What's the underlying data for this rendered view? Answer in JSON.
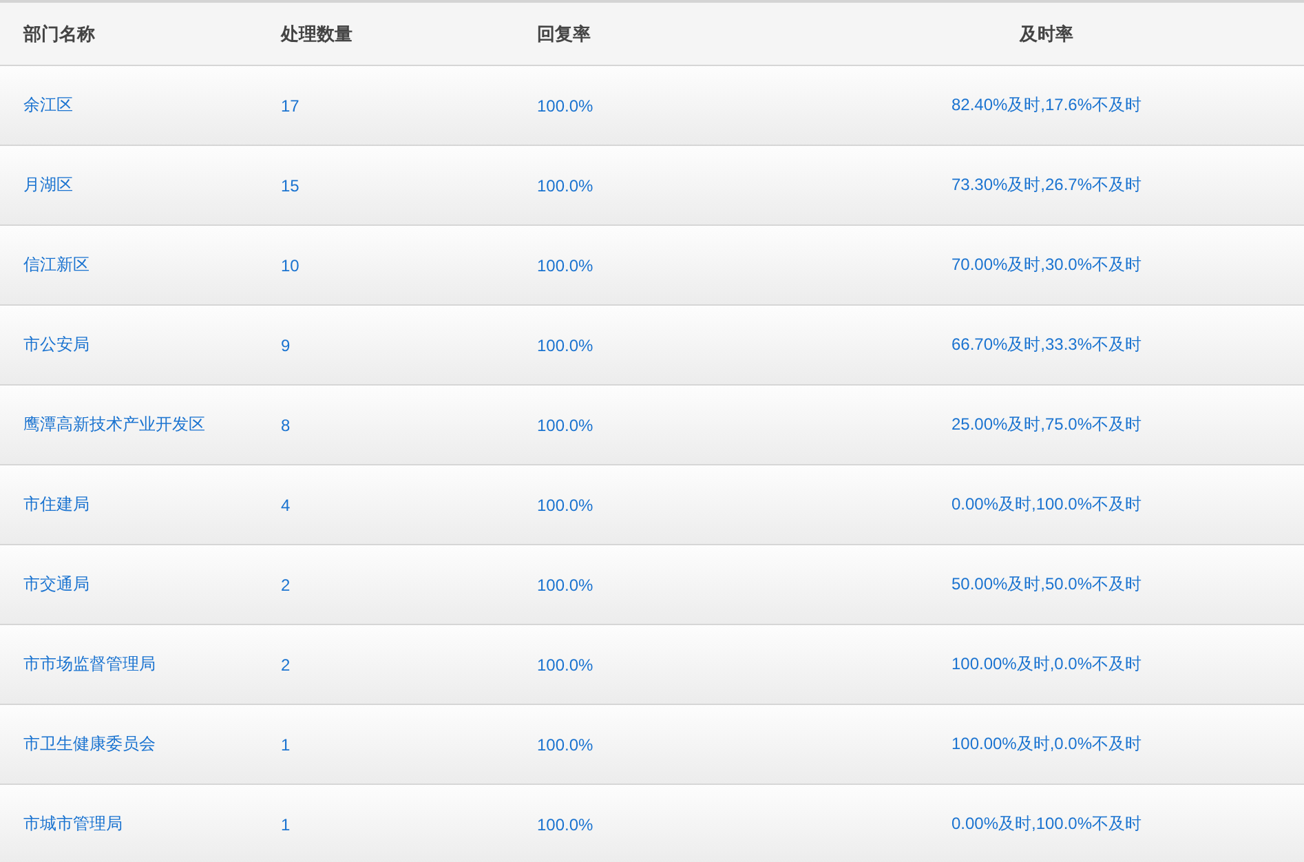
{
  "table": {
    "columns": [
      "部门名称",
      "处理数量",
      "回复率",
      "及时率"
    ],
    "rows": [
      {
        "department": "余江区",
        "count": "17",
        "reply_rate": "100.0%",
        "timeliness": "82.40%及时,17.6%不及时"
      },
      {
        "department": "月湖区",
        "count": "15",
        "reply_rate": "100.0%",
        "timeliness": "73.30%及时,26.7%不及时"
      },
      {
        "department": "信江新区",
        "count": "10",
        "reply_rate": "100.0%",
        "timeliness": "70.00%及时,30.0%不及时"
      },
      {
        "department": "市公安局",
        "count": "9",
        "reply_rate": "100.0%",
        "timeliness": "66.70%及时,33.3%不及时"
      },
      {
        "department": "鹰潭高新技术产业开发区",
        "count": "8",
        "reply_rate": "100.0%",
        "timeliness": "25.00%及时,75.0%不及时"
      },
      {
        "department": "市住建局",
        "count": "4",
        "reply_rate": "100.0%",
        "timeliness": "0.00%及时,100.0%不及时"
      },
      {
        "department": "市交通局",
        "count": "2",
        "reply_rate": "100.0%",
        "timeliness": "50.00%及时,50.0%不及时"
      },
      {
        "department": "市市场监督管理局",
        "count": "2",
        "reply_rate": "100.0%",
        "timeliness": "100.00%及时,0.0%不及时"
      },
      {
        "department": "市卫生健康委员会",
        "count": "1",
        "reply_rate": "100.0%",
        "timeliness": "100.00%及时,0.0%不及时"
      },
      {
        "department": "市城市管理局",
        "count": "1",
        "reply_rate": "100.0%",
        "timeliness": "0.00%及时,100.0%不及时"
      }
    ]
  }
}
